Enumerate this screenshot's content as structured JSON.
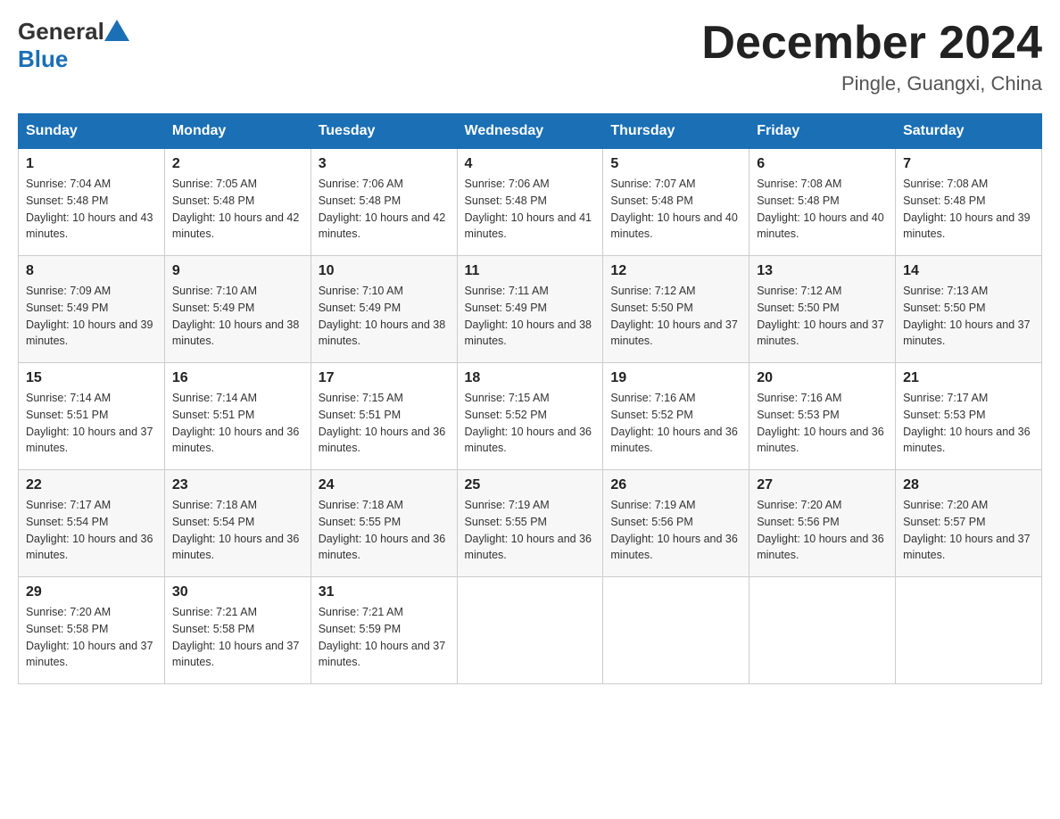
{
  "header": {
    "logo_general": "General",
    "logo_blue": "Blue",
    "month_year": "December 2024",
    "location": "Pingle, Guangxi, China"
  },
  "days_of_week": [
    "Sunday",
    "Monday",
    "Tuesday",
    "Wednesday",
    "Thursday",
    "Friday",
    "Saturday"
  ],
  "weeks": [
    [
      {
        "day": "1",
        "sunrise": "7:04 AM",
        "sunset": "5:48 PM",
        "daylight": "10 hours and 43 minutes."
      },
      {
        "day": "2",
        "sunrise": "7:05 AM",
        "sunset": "5:48 PM",
        "daylight": "10 hours and 42 minutes."
      },
      {
        "day": "3",
        "sunrise": "7:06 AM",
        "sunset": "5:48 PM",
        "daylight": "10 hours and 42 minutes."
      },
      {
        "day": "4",
        "sunrise": "7:06 AM",
        "sunset": "5:48 PM",
        "daylight": "10 hours and 41 minutes."
      },
      {
        "day": "5",
        "sunrise": "7:07 AM",
        "sunset": "5:48 PM",
        "daylight": "10 hours and 40 minutes."
      },
      {
        "day": "6",
        "sunrise": "7:08 AM",
        "sunset": "5:48 PM",
        "daylight": "10 hours and 40 minutes."
      },
      {
        "day": "7",
        "sunrise": "7:08 AM",
        "sunset": "5:48 PM",
        "daylight": "10 hours and 39 minutes."
      }
    ],
    [
      {
        "day": "8",
        "sunrise": "7:09 AM",
        "sunset": "5:49 PM",
        "daylight": "10 hours and 39 minutes."
      },
      {
        "day": "9",
        "sunrise": "7:10 AM",
        "sunset": "5:49 PM",
        "daylight": "10 hours and 38 minutes."
      },
      {
        "day": "10",
        "sunrise": "7:10 AM",
        "sunset": "5:49 PM",
        "daylight": "10 hours and 38 minutes."
      },
      {
        "day": "11",
        "sunrise": "7:11 AM",
        "sunset": "5:49 PM",
        "daylight": "10 hours and 38 minutes."
      },
      {
        "day": "12",
        "sunrise": "7:12 AM",
        "sunset": "5:50 PM",
        "daylight": "10 hours and 37 minutes."
      },
      {
        "day": "13",
        "sunrise": "7:12 AM",
        "sunset": "5:50 PM",
        "daylight": "10 hours and 37 minutes."
      },
      {
        "day": "14",
        "sunrise": "7:13 AM",
        "sunset": "5:50 PM",
        "daylight": "10 hours and 37 minutes."
      }
    ],
    [
      {
        "day": "15",
        "sunrise": "7:14 AM",
        "sunset": "5:51 PM",
        "daylight": "10 hours and 37 minutes."
      },
      {
        "day": "16",
        "sunrise": "7:14 AM",
        "sunset": "5:51 PM",
        "daylight": "10 hours and 36 minutes."
      },
      {
        "day": "17",
        "sunrise": "7:15 AM",
        "sunset": "5:51 PM",
        "daylight": "10 hours and 36 minutes."
      },
      {
        "day": "18",
        "sunrise": "7:15 AM",
        "sunset": "5:52 PM",
        "daylight": "10 hours and 36 minutes."
      },
      {
        "day": "19",
        "sunrise": "7:16 AM",
        "sunset": "5:52 PM",
        "daylight": "10 hours and 36 minutes."
      },
      {
        "day": "20",
        "sunrise": "7:16 AM",
        "sunset": "5:53 PM",
        "daylight": "10 hours and 36 minutes."
      },
      {
        "day": "21",
        "sunrise": "7:17 AM",
        "sunset": "5:53 PM",
        "daylight": "10 hours and 36 minutes."
      }
    ],
    [
      {
        "day": "22",
        "sunrise": "7:17 AM",
        "sunset": "5:54 PM",
        "daylight": "10 hours and 36 minutes."
      },
      {
        "day": "23",
        "sunrise": "7:18 AM",
        "sunset": "5:54 PM",
        "daylight": "10 hours and 36 minutes."
      },
      {
        "day": "24",
        "sunrise": "7:18 AM",
        "sunset": "5:55 PM",
        "daylight": "10 hours and 36 minutes."
      },
      {
        "day": "25",
        "sunrise": "7:19 AM",
        "sunset": "5:55 PM",
        "daylight": "10 hours and 36 minutes."
      },
      {
        "day": "26",
        "sunrise": "7:19 AM",
        "sunset": "5:56 PM",
        "daylight": "10 hours and 36 minutes."
      },
      {
        "day": "27",
        "sunrise": "7:20 AM",
        "sunset": "5:56 PM",
        "daylight": "10 hours and 36 minutes."
      },
      {
        "day": "28",
        "sunrise": "7:20 AM",
        "sunset": "5:57 PM",
        "daylight": "10 hours and 37 minutes."
      }
    ],
    [
      {
        "day": "29",
        "sunrise": "7:20 AM",
        "sunset": "5:58 PM",
        "daylight": "10 hours and 37 minutes."
      },
      {
        "day": "30",
        "sunrise": "7:21 AM",
        "sunset": "5:58 PM",
        "daylight": "10 hours and 37 minutes."
      },
      {
        "day": "31",
        "sunrise": "7:21 AM",
        "sunset": "5:59 PM",
        "daylight": "10 hours and 37 minutes."
      },
      null,
      null,
      null,
      null
    ]
  ],
  "labels": {
    "sunrise_prefix": "Sunrise: ",
    "sunset_prefix": "Sunset: ",
    "daylight_prefix": "Daylight: "
  }
}
